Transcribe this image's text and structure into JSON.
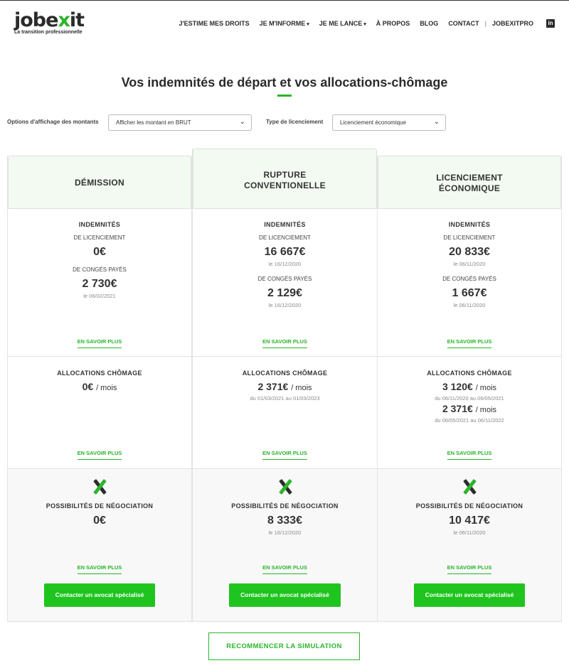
{
  "header": {
    "logo_text_main": "jobe",
    "logo_text_x": "x",
    "logo_text_end": "it",
    "logo_tagline": "La transition professionnelle",
    "nav": [
      "J'ESTIME MES DROITS",
      "JE M'INFORME",
      "JE ME LANCE",
      "À PROPOS",
      "BLOG",
      "CONTACT",
      "JOBEXITPRO"
    ],
    "nav_separator": "|",
    "linkedin_glyph": "in"
  },
  "title": "Vos indemnités de départ et vos allocations-chômage",
  "filters": {
    "display_label": "Options d'affichage des montants",
    "display_value": "Afficher les montant en BRUT",
    "type_label": "Type de licenciement",
    "type_value": "Licenciement économique"
  },
  "labels": {
    "indemnites": "INDEMNITÉS",
    "de_licenciement": "DE LICENCIEMENT",
    "de_conges": "DE CONGÉS PAYÉS",
    "allocations": "ALLOCATIONS CHÔMAGE",
    "per_month": "/ mois",
    "negotiation": "POSSIBILITÉS DE NÉGOCIATION",
    "learn_more": "EN SAVOIR PLUS",
    "contact_lawyer": "Contacter un avocat spécialisé"
  },
  "columns": [
    {
      "title_1": "DÉMISSION",
      "title_2": "",
      "lic_amount": "0€",
      "lic_date": "",
      "conges_amount": "2 730€",
      "conges_date": "le 06/02/2021",
      "alloc_amount": "0€",
      "alloc_date": "",
      "alloc2_amount": "",
      "alloc2_date": "",
      "neg_amount": "0€",
      "neg_date": ""
    },
    {
      "title_1": "RUPTURE",
      "title_2": "CONVENTIONELLE",
      "lic_amount": "16 667€",
      "lic_date": "le 16/12/2020",
      "conges_amount": "2 129€",
      "conges_date": "le 16/12/2020",
      "alloc_amount": "2 371€",
      "alloc_date": "du 01/03/2021 au 01/03/2023",
      "alloc2_amount": "",
      "alloc2_date": "",
      "neg_amount": "8 333€",
      "neg_date": "le 16/12/2020"
    },
    {
      "title_1": "LICENCIEMENT",
      "title_2": "ÉCONOMIQUE",
      "lic_amount": "20 833€",
      "lic_date": "le 06/11/2020",
      "conges_amount": "1 667€",
      "conges_date": "le 06/11/2020",
      "alloc_amount": "3 120€",
      "alloc_date": "du 06/11/2020 au 06/05/2021",
      "alloc2_amount": "2 371€",
      "alloc2_date": "du 06/05/2021 au 06/11/2022",
      "neg_amount": "10 417€",
      "neg_date": "le 06/11/2020"
    }
  ],
  "restart_label": "RECOMMENCER LA SIMULATION",
  "colors": {
    "accent": "#2bb52b",
    "button": "#1fc41f",
    "header_bg": "#f2faf1"
  }
}
